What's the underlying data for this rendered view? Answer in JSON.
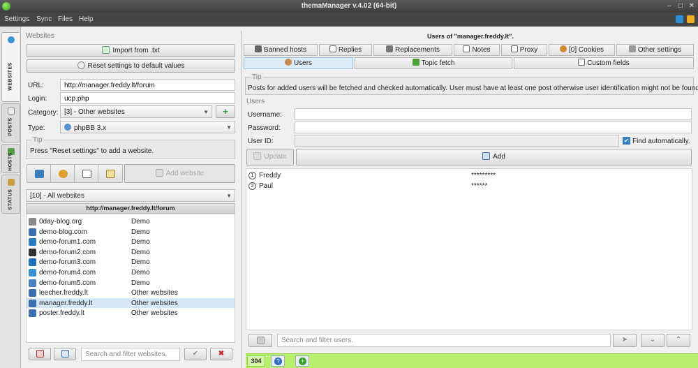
{
  "window": {
    "title": "themaManager v.4.02  (64-bit)",
    "min": "–",
    "max": "□",
    "close": "✕"
  },
  "menu": [
    "Settings",
    "Sync",
    "Files",
    "Help"
  ],
  "sidetabs": [
    {
      "label": "WEBSITES",
      "icon": "globe-icon"
    },
    {
      "label": "POSTS",
      "icon": "document-icon"
    },
    {
      "label": "HOSTS",
      "icon": "hosts-icon"
    },
    {
      "label": "STATUS",
      "icon": "status-icon"
    }
  ],
  "websites": {
    "group_label": "Websites",
    "import_label": "Import from .txt",
    "reset_label": "Reset settings to default values",
    "url_label": "URL:",
    "url_value": "http://manager.freddy.lt/forum",
    "login_label": "Login:",
    "login_value": "ucp.php",
    "category_label": "Category:",
    "category_value": "[3] - Other websites",
    "add_category": "+",
    "type_label": "Type:",
    "type_value": "phpBB 3.x",
    "tip_title": "Tip",
    "tip_text": "Press \"Reset settings\" to add a website.",
    "add_website_label": "Add website",
    "filter_value": "[10] - All websites",
    "list_header": "http://manager.freddy.lt/forum",
    "sites": [
      {
        "name": "0day-blog.org",
        "group": "Demo",
        "color": "#888888"
      },
      {
        "name": "demo-blog.com",
        "group": "Demo",
        "color": "#3b6fb0"
      },
      {
        "name": "demo-forum1.com",
        "group": "Demo",
        "color": "#2a7fc0"
      },
      {
        "name": "demo-forum2.com",
        "group": "Demo",
        "color": "#333333"
      },
      {
        "name": "demo-forum3.com",
        "group": "Demo",
        "color": "#1d6fb8"
      },
      {
        "name": "demo-forum4.com",
        "group": "Demo",
        "color": "#3a8fd0"
      },
      {
        "name": "demo-forum5.com",
        "group": "Demo",
        "color": "#4a7fc0"
      },
      {
        "name": "leecher.freddy.lt",
        "group": "Other websites",
        "color": "#3b6fb0"
      },
      {
        "name": "manager.freddy.lt",
        "group": "Other websites",
        "color": "#3b6fb0"
      },
      {
        "name": "poster.freddy.lt",
        "group": "Other websites",
        "color": "#3b6fb0"
      }
    ],
    "search_placeholder": "Search and filter websites."
  },
  "users_panel": {
    "header": "Users of \"manager.freddy.lt\".",
    "tabs_row1": [
      "Banned hosts",
      "Replies",
      "Replacements",
      "Notes",
      "Proxy",
      "[0] Cookies",
      "Other settings"
    ],
    "tabs_row2": [
      "Users",
      "Topic fetch",
      "Custom fields"
    ],
    "tip_title": "Tip",
    "tip_text": "Posts for added users will be fetched and checked automatically. User must have at least one post otherwise user identification might not be found.",
    "users_group": "Users",
    "username_label": "Username:",
    "password_label": "Password:",
    "userid_label": "User ID:",
    "find_auto_label": "Find automatically.",
    "update_label": "Update",
    "add_label": "Add",
    "users": [
      {
        "num": "1",
        "name": "Freddy",
        "password": "*********"
      },
      {
        "num": "2",
        "name": "Paul",
        "password": "******"
      }
    ],
    "search_placeholder": "Search and filter users."
  },
  "status": {
    "count": "304"
  },
  "colors": {
    "accent": "#b8ef6c",
    "selection": "#d6e8f7"
  }
}
